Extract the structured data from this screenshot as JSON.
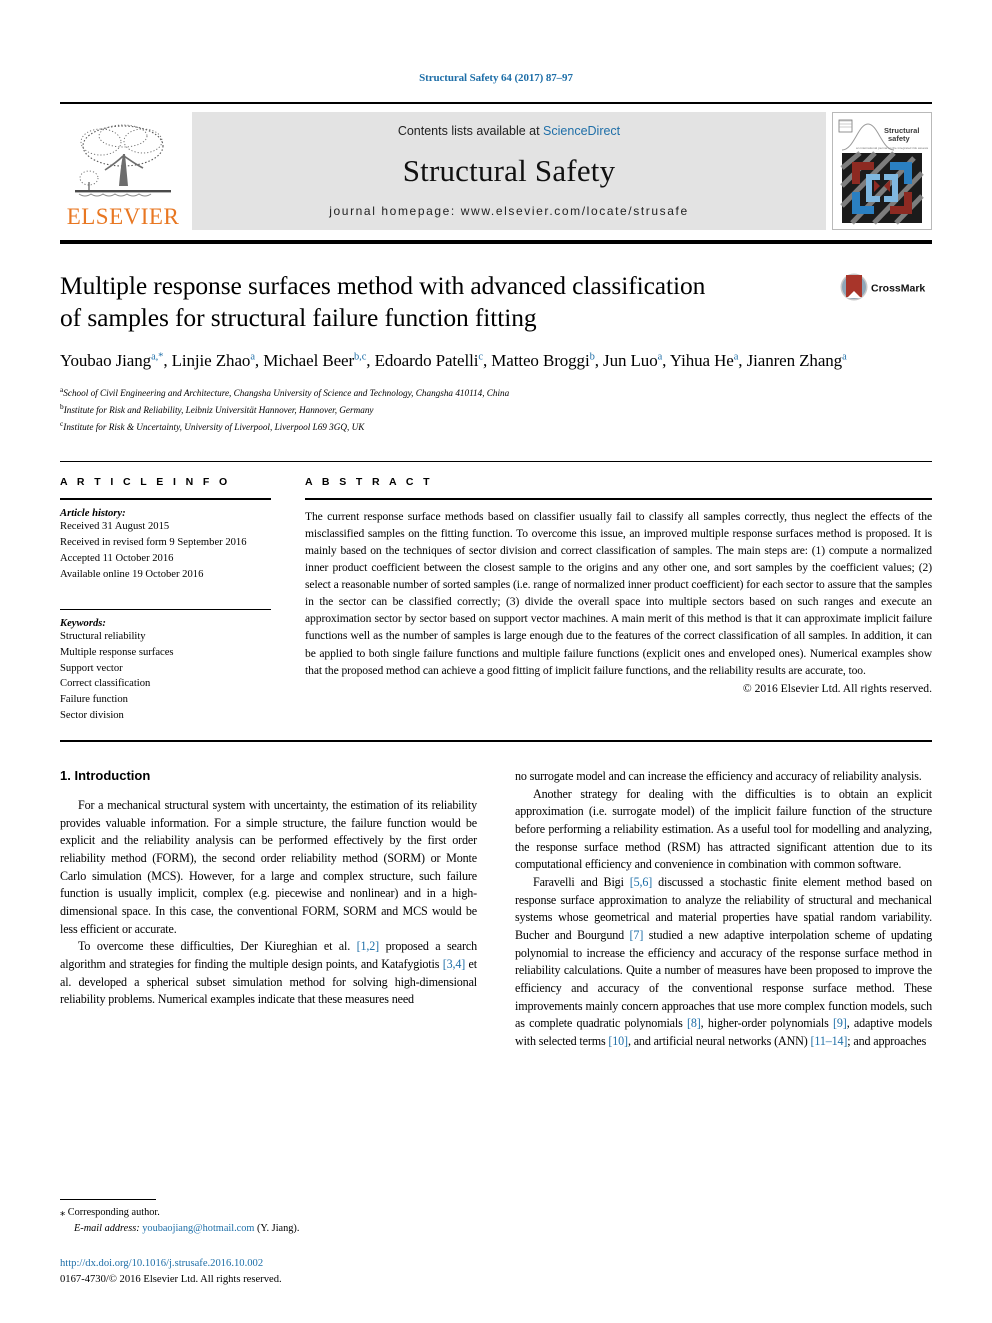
{
  "running_head": "Structural Safety 64 (2017) 87–97",
  "masthead": {
    "publisher_name": "ELSEVIER",
    "contents_prefix": "Contents lists available at ",
    "contents_link": "ScienceDirect",
    "journal_title": "Structural Safety",
    "homepage_text": "journal homepage: www.elsevier.com/locate/strusafe",
    "cover_title_line1": "Structural",
    "cover_title_line2": "safety",
    "cover_subtitle": "an international journal on the integrated risk assessment of structures"
  },
  "article": {
    "title_line1": "Multiple response surfaces method with advanced classification",
    "title_line2": "of samples for structural failure function fitting",
    "crossmark_label": "CrossMark",
    "authors": [
      {
        "name": "Youbao Jiang",
        "marks": "a,*",
        "sep": ", "
      },
      {
        "name": "Linjie Zhao",
        "marks": "a",
        "sep": ", "
      },
      {
        "name": "Michael Beer",
        "marks": "b,c",
        "sep": ", "
      },
      {
        "name": "Edoardo Patelli",
        "marks": "c",
        "sep": ", "
      },
      {
        "name": "Matteo Broggi",
        "marks": "b",
        "sep": ", "
      },
      {
        "name": "Jun Luo",
        "marks": "a",
        "sep": ", "
      },
      {
        "name": "Yihua He",
        "marks": "a",
        "sep": ", "
      },
      {
        "name": "Jianren Zhang",
        "marks": "a",
        "sep": ""
      }
    ],
    "affiliations": [
      {
        "mark": "a",
        "text": "School of Civil Engineering and Architecture, Changsha University of Science and Technology, Changsha 410114, China"
      },
      {
        "mark": "b",
        "text": "Institute for Risk and Reliability, Leibniz Universität Hannover, Hannover, Germany"
      },
      {
        "mark": "c",
        "text": "Institute for Risk & Uncertainty, University of Liverpool, Liverpool L69 3GQ, UK"
      }
    ]
  },
  "article_info": {
    "label": "A R T I C L E  I N F O",
    "history_heading": "Article history:",
    "history": [
      "Received 31 August 2015",
      "Received in revised form 9 September 2016",
      "Accepted 11 October 2016",
      "Available online 19 October 2016"
    ],
    "keywords_heading": "Keywords:",
    "keywords": [
      "Structural reliability",
      "Multiple response surfaces",
      "Support vector",
      "Correct classification",
      "Failure function",
      "Sector division"
    ]
  },
  "abstract": {
    "label": "A B S T R A C T",
    "text": "The current response surface methods based on classifier usually fail to classify all samples correctly, thus neglect the effects of the misclassified samples on the fitting function. To overcome this issue, an improved multiple response surfaces method is proposed. It is mainly based on the techniques of sector division and correct classification of samples. The main steps are: (1) compute a normalized inner product coefficient between the closest sample to the origins and any other one, and sort samples by the coefficient values; (2) select a reasonable number of sorted samples (i.e. range of normalized inner product coefficient) for each sector to assure that the samples in the sector can be classified correctly; (3) divide the overall space into multiple sectors based on such ranges and execute an approximation sector by sector based on support vector machines. A main merit of this method is that it can approximate implicit failure functions well as the number of samples is large enough due to the features of the correct classification of all samples. In addition, it can be applied to both single failure functions and multiple failure functions (explicit ones and enveloped ones). Numerical examples show that the proposed method can achieve a good fitting of implicit failure functions, and the reliability results are accurate, too.",
    "copyright": "© 2016 Elsevier Ltd. All rights reserved."
  },
  "body": {
    "section_title": "1. Introduction",
    "left_paragraphs": [
      {
        "parts": [
          {
            "t": "For a mechanical structural system with uncertainty, the estimation of its reliability provides valuable information. For a simple structure, the failure function would be explicit and the reliability analysis can be performed effectively by the first order reliability method (FORM), the second order reliability method (SORM) or Monte Carlo simulation (MCS). However, for a large and complex structure, such failure function is usually implicit, complex (e.g. piecewise and nonlinear) and in a high-dimensional space. In this case, the conventional FORM, SORM and MCS would be less efficient or accurate."
          }
        ]
      },
      {
        "parts": [
          {
            "t": "To overcome these difficulties, Der Kiureghian et al. "
          },
          {
            "t": "[1,2]",
            "ref": true
          },
          {
            "t": " proposed a search algorithm and strategies for finding the multiple design points, and Katafygiotis "
          },
          {
            "t": "[3,4]",
            "ref": true
          },
          {
            "t": " et al. developed a spherical subset simulation method for solving high-dimensional reliability problems. Numerical examples indicate that these measures need"
          }
        ]
      }
    ],
    "right_paragraphs": [
      {
        "noindent": true,
        "parts": [
          {
            "t": "no surrogate model and can increase the efficiency and accuracy of reliability analysis."
          }
        ]
      },
      {
        "parts": [
          {
            "t": "Another strategy for dealing with the difficulties is to obtain an explicit approximation (i.e. surrogate model) of the implicit failure function of the structure before performing a reliability estimation. As a useful tool for modelling and analyzing, the response surface method (RSM) has attracted significant attention due to its computational efficiency and convenience in combination with common software."
          }
        ]
      },
      {
        "parts": [
          {
            "t": "Faravelli and Bigi "
          },
          {
            "t": "[5,6]",
            "ref": true
          },
          {
            "t": " discussed a stochastic finite element method based on response surface approximation to analyze the reliability of structural and mechanical systems whose geometrical and material properties have spatial random variability. Bucher and Bourgund "
          },
          {
            "t": "[7]",
            "ref": true
          },
          {
            "t": " studied a new adaptive interpolation scheme of updating polynomial to increase the efficiency and accuracy of the response surface method in reliability calculations. Quite a number of measures have been proposed to improve the efficiency and accuracy of the conventional response surface method. These improvements mainly concern approaches that use more complex function models, such as complete quadratic polynomials "
          },
          {
            "t": "[8]",
            "ref": true
          },
          {
            "t": ", higher-order polynomials "
          },
          {
            "t": "[9]",
            "ref": true
          },
          {
            "t": ", adaptive models with selected terms "
          },
          {
            "t": "[10]",
            "ref": true
          },
          {
            "t": ", and artificial neural networks (ANN) "
          },
          {
            "t": "[11–14]",
            "ref": true
          },
          {
            "t": "; and approaches"
          }
        ]
      }
    ]
  },
  "footnote": {
    "corresponding_marker": "⁎",
    "corresponding_text": "Corresponding author.",
    "email_label": "E-mail address:",
    "email": "youbaojiang@hotmail.com",
    "email_suffix": "(Y. Jiang).",
    "doi_url": "http://dx.doi.org/10.1016/j.strusafe.2016.10.002",
    "issn_line": "0167-4730/© 2016 Elsevier Ltd. All rights reserved."
  },
  "colors": {
    "link": "#1f6fa8",
    "elsevier_orange": "#E87722",
    "band_gray": "#e3e3e3",
    "cover_blue": "#2a7fc1",
    "cover_lightblue": "#7fb8e0",
    "cover_red": "#8d2a22",
    "cover_gray": "#8f8f8f"
  }
}
